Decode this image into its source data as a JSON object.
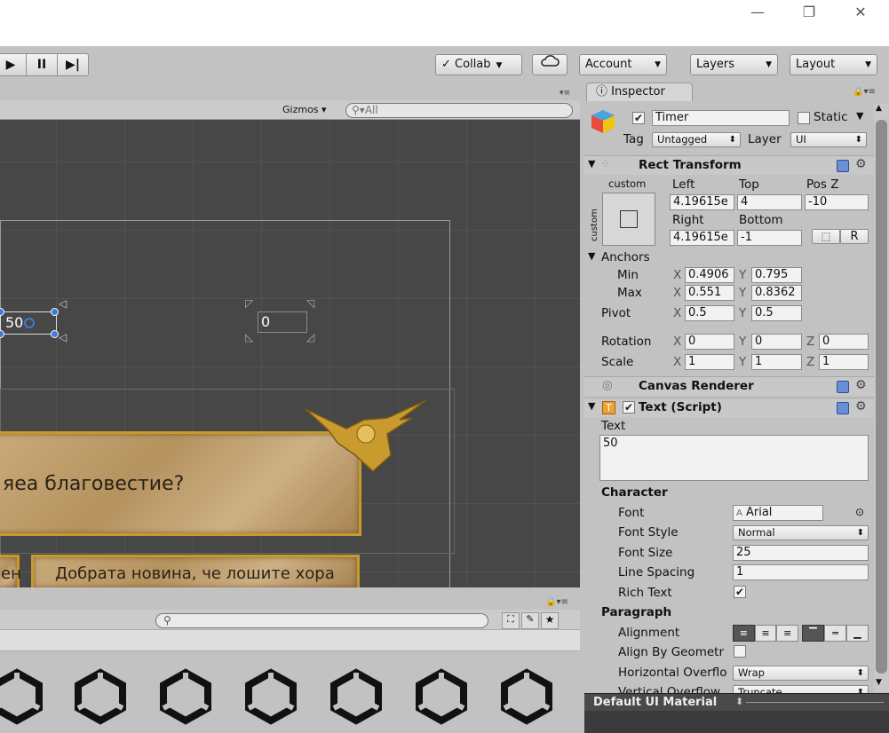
{
  "window": {
    "minimize": "—",
    "restore": "❐",
    "close": "✕"
  },
  "toolbar": {
    "play": "▶",
    "pause": "II",
    "step": "▶|",
    "collab_label": "Collab",
    "cloud_icon": "cloud-icon",
    "account_label": "Account",
    "layers_label": "Layers",
    "layout_label": "Layout"
  },
  "scene": {
    "gizmos_label": "Gizmos",
    "search_placeholder": "All",
    "timer_value": "50",
    "second_value": "0",
    "question_text": "яеа благовестие?",
    "answer_left_text": "ен",
    "answer_right_text": "Добрата новина, че лошите хора"
  },
  "inspector": {
    "tab_label": "Inspector",
    "object_name": "Timer",
    "static_label": "Static",
    "tag_label": "Tag",
    "tag_value": "Untagged",
    "layer_label": "Layer",
    "layer_value": "UI",
    "rect_transform": {
      "title": "Rect Transform",
      "anchor_preset": "custom",
      "side_label": "custom",
      "left_label": "Left",
      "top_label": "Top",
      "posz_label": "Pos Z",
      "left": "4.19615e",
      "top": "4",
      "posz": "-10",
      "right_label": "Right",
      "bottom_label": "Bottom",
      "right": "4.19615e",
      "bottom": "-1",
      "r_button": "R",
      "anchors_label": "Anchors",
      "min_label": "Min",
      "max_label": "Max",
      "min_x": "0.4906",
      "min_y": "0.795",
      "max_x": "0.551",
      "max_y": "0.8362",
      "pivot_label": "Pivot",
      "pivot_x": "0.5",
      "pivot_y": "0.5",
      "rotation_label": "Rotation",
      "rot_x": "0",
      "rot_y": "0",
      "rot_z": "0",
      "scale_label": "Scale",
      "scale_x": "1",
      "scale_y": "1",
      "scale_z": "1",
      "x": "X",
      "y": "Y",
      "z": "Z"
    },
    "canvas_renderer": "Canvas Renderer",
    "text_script": {
      "title": "Text (Script)",
      "text_label": "Text",
      "text_value": "50",
      "character_label": "Character",
      "font_label": "Font",
      "font_value": "Arial",
      "font_style_label": "Font Style",
      "font_style_value": "Normal",
      "font_size_label": "Font Size",
      "font_size_value": "25",
      "line_spacing_label": "Line Spacing",
      "line_spacing_value": "1",
      "rich_text_label": "Rich Text",
      "paragraph_label": "Paragraph",
      "alignment_label": "Alignment",
      "align_geometry_label": "Align By Geometr",
      "horizontal_overflow_label": "Horizontal Overflo",
      "horizontal_overflow_value": "Wrap",
      "vertical_overflow_label": "Vertical Overflow",
      "vertical_overflow_value": "Truncate"
    },
    "material_label": "Default UI Material"
  }
}
